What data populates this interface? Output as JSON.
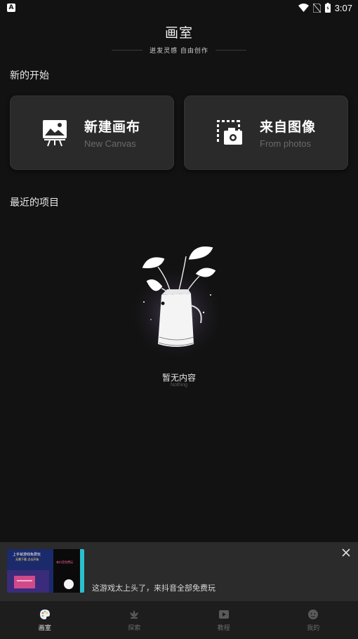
{
  "status_bar": {
    "left_icon": "A",
    "time": "3:07",
    "icons": [
      "wifi-icon",
      "no-sim-icon",
      "battery-icon"
    ]
  },
  "header": {
    "title": "画室",
    "subtitle": "迸发灵感 自由创作"
  },
  "sections": {
    "new_start": "新的开始",
    "recent_projects": "最近的项目"
  },
  "cards": [
    {
      "title": "新建画布",
      "subtitle": "New Canvas",
      "icon": "easel-icon"
    },
    {
      "title": "来自图像",
      "subtitle": "From photos",
      "icon": "camera-frame-icon"
    }
  ],
  "empty_state": {
    "title": "暂无内容",
    "subtitle": "Nothing",
    "icon": "plant-vase-illustration"
  },
  "ad": {
    "text": "这游戏太上头了，来抖音全部免费玩",
    "thumb_caption_1": "上手就游戏免费玩",
    "thumb_caption_2": "无需下载 点击开始",
    "thumb_caption_3": "来抖音免费玩"
  },
  "bottom_nav": [
    {
      "label": "画室",
      "icon": "palette-icon",
      "active": true
    },
    {
      "label": "探索",
      "icon": "lotus-icon",
      "active": false
    },
    {
      "label": "教程",
      "icon": "video-icon",
      "active": false
    },
    {
      "label": "我的",
      "icon": "user-face-icon",
      "active": false
    }
  ],
  "colors": {
    "background": "#121212",
    "card": "#2a2a2a",
    "ad_background": "#2b2b2b",
    "nav_background": "#1d1d1d",
    "active_label": "#e8e8e8",
    "inactive_label": "#6a6a6a"
  }
}
